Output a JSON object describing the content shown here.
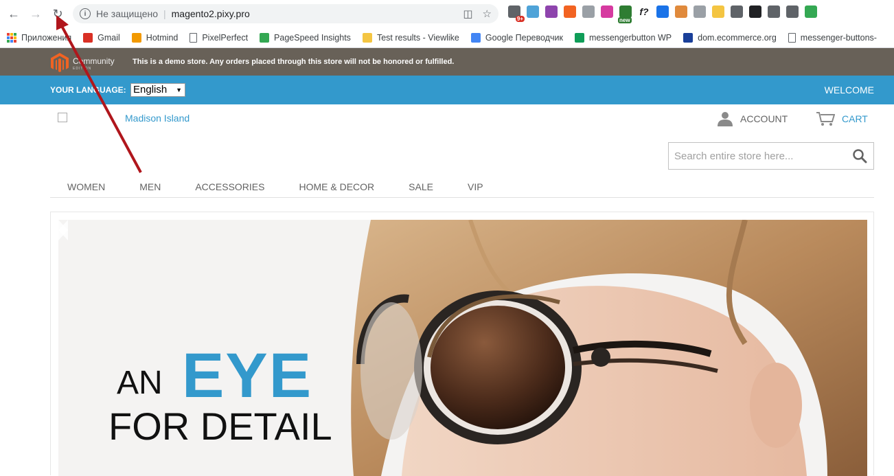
{
  "browser": {
    "url_security": "Не защищено",
    "url": "magento2.pixy.pro",
    "bookmarks": [
      {
        "label": "Приложения",
        "icon": "apps-grid-icon"
      },
      {
        "label": "Gmail",
        "icon": "gmail-icon"
      },
      {
        "label": "Hotmind",
        "icon": "hotmind-icon"
      },
      {
        "label": "PixelPerfect",
        "icon": "page-icon"
      },
      {
        "label": "PageSpeed Insights",
        "icon": "pagespeed-icon"
      },
      {
        "label": "Test results - Viewlike",
        "icon": "viewlike-icon"
      },
      {
        "label": "Google Переводчик",
        "icon": "translate-icon"
      },
      {
        "label": "messengerbutton WP",
        "icon": "sheets-icon"
      },
      {
        "label": "dom.ecommerce.org",
        "icon": "flag-icon"
      },
      {
        "label": "messenger-buttons-",
        "icon": "page-icon"
      }
    ],
    "extensions": [
      {
        "icon": "extension-chat-icon",
        "color": "#5f6368",
        "badge": "9+"
      },
      {
        "icon": "extension-cube-icon",
        "color": "#4fa3d8"
      },
      {
        "icon": "extension-feather-icon",
        "color": "#8e44ad"
      },
      {
        "icon": "extension-magento-icon",
        "color": "#f26322"
      },
      {
        "icon": "extension-shield-icon",
        "color": "#9aa0a6"
      },
      {
        "icon": "extension-gradient-icon",
        "color": "#d63aa0"
      },
      {
        "icon": "extension-new-icon",
        "color": "#2e7d32",
        "badge_new": "new"
      },
      {
        "icon": "extension-font-icon",
        "color": "#202124",
        "text": "f?"
      },
      {
        "icon": "extension-picker-icon",
        "color": "#1a73e8"
      },
      {
        "icon": "extension-ruler-icon",
        "color": "#e08a3c"
      },
      {
        "icon": "extension-pen-icon",
        "color": "#9aa0a6"
      },
      {
        "icon": "extension-note-icon",
        "color": "#f4c542"
      },
      {
        "icon": "extension-move-icon",
        "color": "#5f6368"
      },
      {
        "icon": "extension-circle-icon",
        "color": "#202124"
      },
      {
        "icon": "extension-corner-icon",
        "color": "#5f6368"
      },
      {
        "icon": "extension-gear-icon",
        "color": "#5f6368"
      },
      {
        "icon": "extension-eye-icon",
        "color": "#34a853"
      }
    ]
  },
  "store": {
    "demo_notice": "This is a demo store. Any orders placed through this store will not be honored or fulfilled.",
    "community_label": "Community",
    "community_sub": "EDITION",
    "language_label": "YOUR LANGUAGE:",
    "language_value": "English",
    "welcome": "WELCOME",
    "store_name": "Madison Island",
    "account_label": "ACCOUNT",
    "cart_label": "CART",
    "search_placeholder": "Search entire store here...",
    "nav": [
      "WOMEN",
      "MEN",
      "ACCESSORIES",
      "HOME & DECOR",
      "SALE",
      "VIP"
    ],
    "colors": {
      "accent": "#3399cc",
      "demo_bar": "#686158"
    }
  },
  "hero": {
    "line1": "AN",
    "highlight": "EYE",
    "line2": "FOR DETAIL"
  }
}
